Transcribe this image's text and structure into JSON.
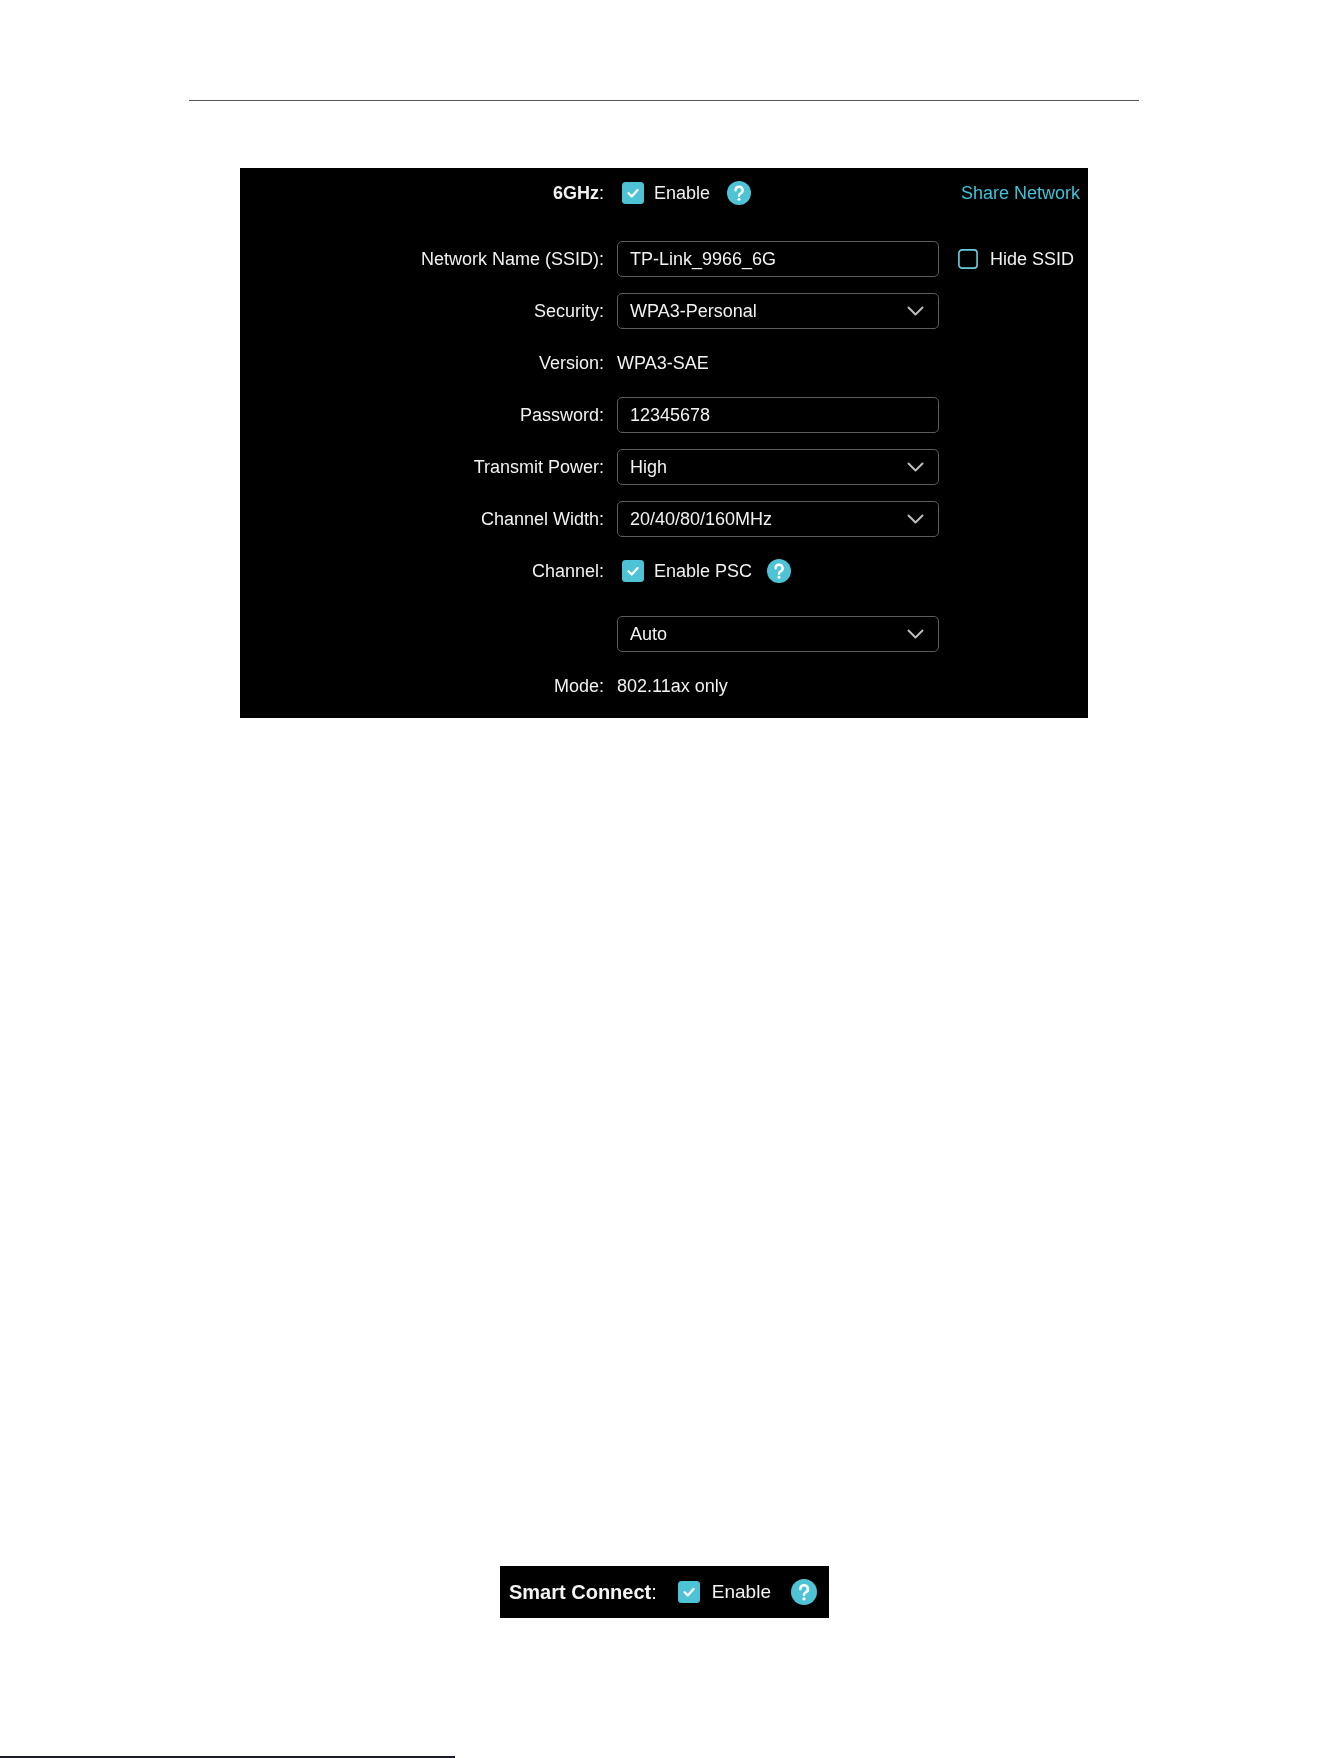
{
  "band": {
    "label": "**6GHz**:",
    "enable": {
      "label": "Enable",
      "checked": true,
      "help": true
    },
    "share_link": "Share Network"
  },
  "fields": [
    {
      "kind": "input",
      "label": "Network Name (SSID):",
      "value": "TP-Link_9966_6G",
      "side_checkbox": {
        "label": "Hide SSID",
        "checked": false
      }
    },
    {
      "kind": "select",
      "label": "Security:",
      "value": "WPA3-Personal"
    },
    {
      "kind": "static",
      "label": "Version:",
      "value": "WPA3-SAE"
    },
    {
      "kind": "input",
      "label": "Password:",
      "value": "12345678"
    },
    {
      "kind": "select",
      "label": "Transmit Power:",
      "value": "High"
    },
    {
      "kind": "select",
      "label": "Channel Width:",
      "value": "20/40/80/160MHz"
    },
    {
      "kind": "checkbox",
      "label": "Channel:",
      "option": {
        "label": "Enable PSC",
        "checked": true,
        "help": true
      }
    },
    {
      "kind": "select",
      "value": "Auto"
    },
    {
      "kind": "static",
      "label": "Mode:",
      "value": "802.11ax only"
    }
  ],
  "smart_connect": {
    "label": "**Smart Connect**:",
    "enable": {
      "label": "Enable",
      "checked": true,
      "help": true
    }
  }
}
